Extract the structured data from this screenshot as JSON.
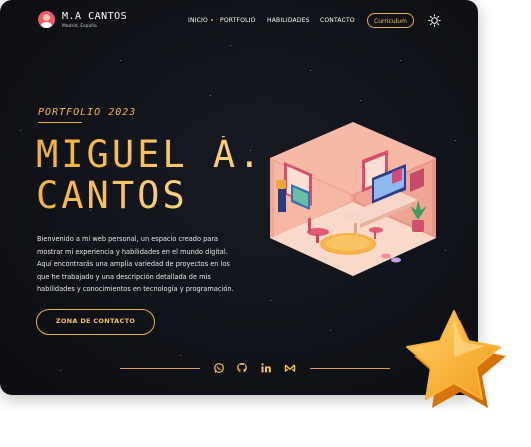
{
  "header": {
    "logo_name": "M.A CANTOS",
    "logo_location": "Madrid, España",
    "nav": [
      {
        "label": "INICIO"
      },
      {
        "label": "PORTFOLIO"
      },
      {
        "label": "HABILIDADES"
      },
      {
        "label": "CONTACTO"
      }
    ],
    "cv_button": "Curriculum",
    "theme_icon": "sun-icon"
  },
  "hero": {
    "eyebrow": "PORTFOLIO 2023",
    "title_line1": "MIGUEL Á.",
    "title_line2": "CANTOS",
    "intro": [
      "Bienvenido a mi web personal, un espacio creado para",
      "mostrar mi experiencia y habilidades en el mundo digital.",
      "Aquí encontrarás una amplia variedad de proyectos en los",
      "que he trabajado y una descripción detallada de mis",
      "habilidades y conocimientos en tecnología y programación."
    ],
    "cta": "ZONA DE CONTACTO"
  },
  "social": [
    {
      "icon": "whatsapp-icon"
    },
    {
      "icon": "github-icon"
    },
    {
      "icon": "linkedin-icon"
    },
    {
      "icon": "mail-icon"
    }
  ],
  "colors": {
    "accent": "#f3b13f",
    "background": "#0f1117",
    "text": "#ffffff"
  }
}
